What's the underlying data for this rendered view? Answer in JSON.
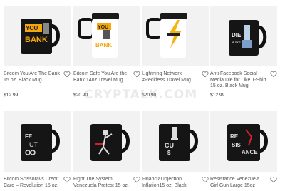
{
  "watermark": "CRYPTALK.COM",
  "products": [
    {
      "title": "Bitcoin You Are The Bank 15 oz. Black Mug",
      "price": "$12.99",
      "mug_style": "black",
      "art": "you-are-the-bank"
    },
    {
      "title": "Bitcoin Safe You Are the Bank 14oz Travel Mug",
      "price": "$20.90",
      "mug_style": "white-travel",
      "art": "you-are-the-bank"
    },
    {
      "title": "Lightning Network #Reckless Travel Mug",
      "price": "$20.90",
      "mug_style": "white-travel",
      "art": "lightning-bolt"
    },
    {
      "title": "Anti Facebook Social Media Die for Like T-Shirt 15 oz. Black Mug",
      "price": "$12.99",
      "mug_style": "black",
      "art": "die-for-like"
    },
    {
      "title": "Bitcoin Scissoravs Credit Card – Revolution 15 oz.",
      "price": "",
      "mug_style": "black",
      "art": "scissors-card"
    },
    {
      "title": "Fight The System Venezuela Protest 15 oz.",
      "price": "",
      "mug_style": "black",
      "art": "fight-the-system"
    },
    {
      "title": "Financial Injection Inflation15 oz. Black",
      "price": "",
      "mug_style": "black",
      "art": "injection"
    },
    {
      "title": "Resistance Venezuela Girl Gun Large 15oz",
      "price": "",
      "mug_style": "black",
      "art": "resistance"
    }
  ]
}
